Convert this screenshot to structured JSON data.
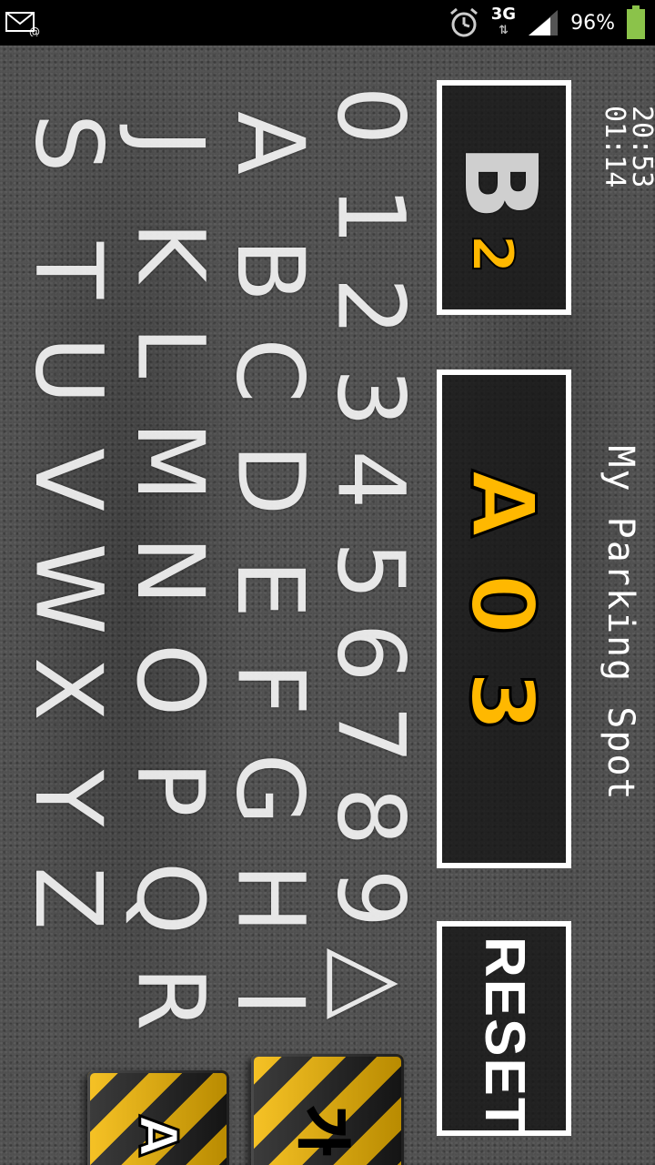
{
  "status_bar": {
    "network": "3G",
    "battery_percent": "96%",
    "icons": [
      "mail-icon",
      "alarm-icon",
      "data-arrows-icon",
      "signal-icon",
      "battery-icon"
    ],
    "battery_color": "#8bc34a"
  },
  "clock": {
    "time": "20:53",
    "duration": "01:14"
  },
  "app": {
    "title": "My Parking Spot"
  },
  "floor": {
    "letter": "B",
    "number": "2"
  },
  "spot": {
    "value": "A03"
  },
  "actions": {
    "reset_label": "RESET"
  },
  "keyboard": {
    "rows": [
      [
        "0",
        "1",
        "2",
        "3",
        "4",
        "5",
        "6",
        "7",
        "8",
        "9",
        "△"
      ],
      [
        "A",
        "B",
        "C",
        "D",
        "E",
        "F",
        "G",
        "H",
        "I"
      ],
      [
        "J",
        "K",
        "L",
        "M",
        "N",
        "O",
        "P",
        "Q",
        "R"
      ],
      [
        "S",
        "T",
        "U",
        "V",
        "W",
        "X",
        "Y",
        "Z"
      ]
    ]
  },
  "mode_buttons": {
    "korean": "가",
    "latin": "A"
  },
  "colors": {
    "accent_yellow": "#ffb800",
    "marking_white": "#ffffff",
    "asphalt": "#4a4a4a"
  }
}
